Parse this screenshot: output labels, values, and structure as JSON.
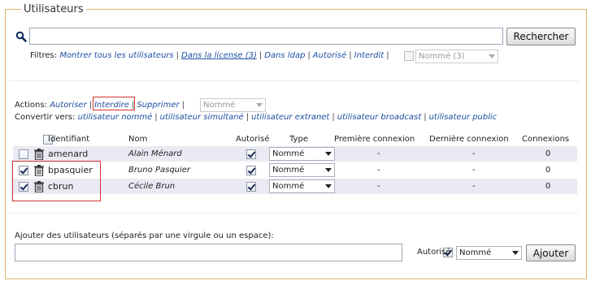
{
  "section_title": "Utilisateurs",
  "search": {
    "value": "",
    "button_label": "Rechercher"
  },
  "filters": {
    "label": "Filtres:",
    "links": [
      {
        "label": "Montrer tous les utilisateurs"
      },
      {
        "label": "Dans la license (3)"
      },
      {
        "label": "Dans ldap"
      },
      {
        "label": "Autorisé"
      },
      {
        "label": "Interdit"
      }
    ],
    "type_select": "Nommé (3)"
  },
  "actions": {
    "label": "Actions:",
    "links": [
      {
        "label": "Autoriser"
      },
      {
        "label": "Interdire"
      },
      {
        "label": "Supprimer"
      }
    ],
    "type_select": "Nommé"
  },
  "convert": {
    "label": "Convertir vers:",
    "links": [
      {
        "label": "utilisateur nommé"
      },
      {
        "label": "utilisateur simultané"
      },
      {
        "label": "utilisateur extranet"
      },
      {
        "label": "utilisateur broadcast"
      },
      {
        "label": "utilisateur public"
      }
    ]
  },
  "table": {
    "headers": [
      "Identifiant",
      "Nom",
      "Autorisé",
      "Type",
      "Première connexion",
      "Dernière connexion",
      "Connexions"
    ],
    "rows": [
      {
        "id": "amenard",
        "name": "Alain Ménard",
        "authorized": true,
        "selected": false,
        "type": "Nommé",
        "first": "-",
        "last": "-",
        "count": "0"
      },
      {
        "id": "bpasquier",
        "name": "Bruno Pasquier",
        "authorized": true,
        "selected": true,
        "type": "Nommé",
        "first": "-",
        "last": "-",
        "count": "0"
      },
      {
        "id": "cbrun",
        "name": "Cécile Brun",
        "authorized": true,
        "selected": true,
        "type": "Nommé",
        "first": "-",
        "last": "-",
        "count": "0"
      }
    ]
  },
  "add_users": {
    "label": "Ajouter des utilisateurs (séparés par une virgule ou un espace):",
    "value": "",
    "authorized_label": "Autorisé",
    "type_select": "Nommé",
    "button_label": "Ajouter"
  },
  "icons": {
    "search": "magnifier-icon",
    "delete": "trash-icon",
    "dropdown": "chevron-down-icon"
  },
  "colors": {
    "link": "#1f4fa0",
    "frame": "#e0b070",
    "highlight": "#d03030",
    "row_shade": "#eaeaf4"
  }
}
